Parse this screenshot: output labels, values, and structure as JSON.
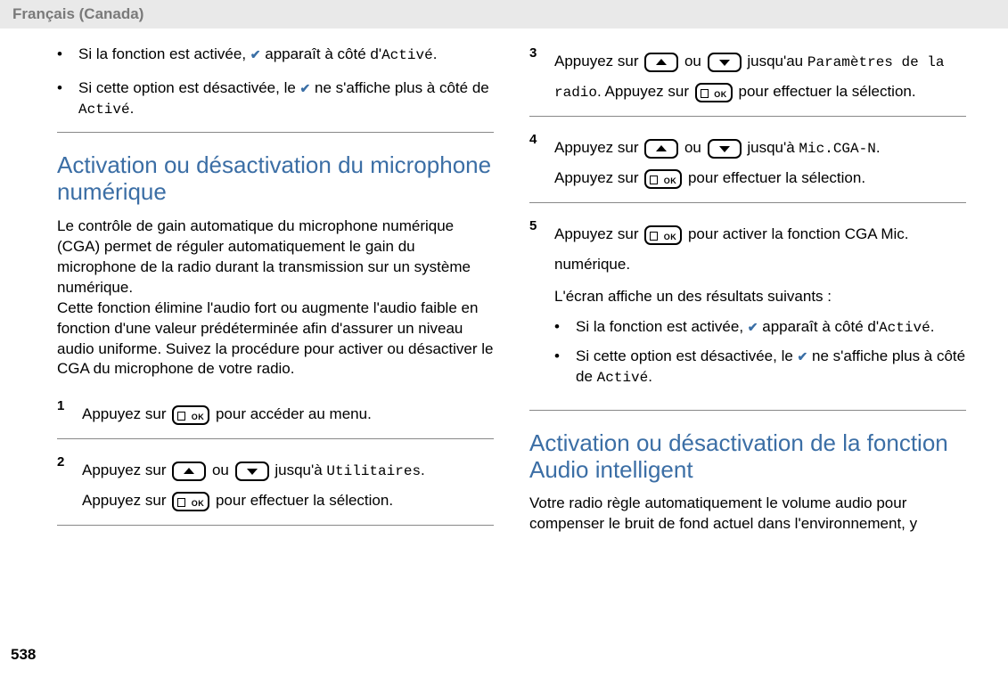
{
  "header": {
    "language": "Français (Canada)"
  },
  "page_number": "538",
  "col1": {
    "top_bullets": [
      {
        "pre": "Si la fonction est activée, ",
        "post": " apparaît à côté d'",
        "mono": "Activé",
        "tail": "."
      },
      {
        "pre": "Si cette option est désactivée, le ",
        "post": " ne s'affiche plus à côté de ",
        "mono": "Activé",
        "tail": "."
      }
    ],
    "section_title": "Activation ou désactivation du microphone numérique",
    "intro": "Le contrôle de gain automatique du microphone numérique (CGA) permet de réguler automatiquement le gain du microphone de la radio durant la transmission sur un système numérique.\nCette fonction élimine l'audio fort ou augmente l'audio faible en fonction d'une valeur prédéterminée afin d'assurer un niveau audio uniforme. Suivez la procédure pour activer ou désactiver le CGA du microphone de votre radio.",
    "steps": {
      "s1": {
        "num": "1",
        "pre": "Appuyez sur ",
        "post": " pour accéder au menu."
      },
      "s2": {
        "num": "2",
        "l1_pre": "Appuyez sur ",
        "l1_mid": " ou ",
        "l1_post": " jusqu'à ",
        "l1_mono": "Utilitaires",
        "l1_tail": ".",
        "l2_pre": "Appuyez sur ",
        "l2_post": " pour effectuer la sélection."
      }
    }
  },
  "col2": {
    "steps": {
      "s3": {
        "num": "3",
        "l1_pre": "Appuyez sur ",
        "l1_mid": " ou ",
        "l1_post": " jusqu'au ",
        "l1_mono": "Paramètres de la radio",
        "l1_tail": ". Appuyez sur ",
        "l1_post2": " pour effectuer la sélection."
      },
      "s4": {
        "num": "4",
        "l1_pre": "Appuyez sur ",
        "l1_mid": " ou ",
        "l1_post": " jusqu'à ",
        "l1_mono": "Mic.CGA-N",
        "l1_tail": ".",
        "l2_pre": "Appuyez sur ",
        "l2_post": " pour effectuer la sélection."
      },
      "s5": {
        "num": "5",
        "l1_pre": "Appuyez sur ",
        "l1_post": " pour activer la fonction CGA Mic. numérique.",
        "result_intro": "L'écran affiche un des résultats suivants :",
        "bullets": [
          {
            "pre": "Si la fonction est activée, ",
            "post": " apparaît à côté d'",
            "mono": "Activé",
            "tail": "."
          },
          {
            "pre": "Si cette option est désactivée, le ",
            "post": " ne s'affiche plus à côté de ",
            "mono": "Activé",
            "tail": "."
          }
        ]
      }
    },
    "section_title": "Activation ou désactivation de la fonction Audio intelligent",
    "intro2": "Votre radio règle automatiquement le volume audio pour compenser le bruit de fond actuel dans l'environnement, y"
  }
}
